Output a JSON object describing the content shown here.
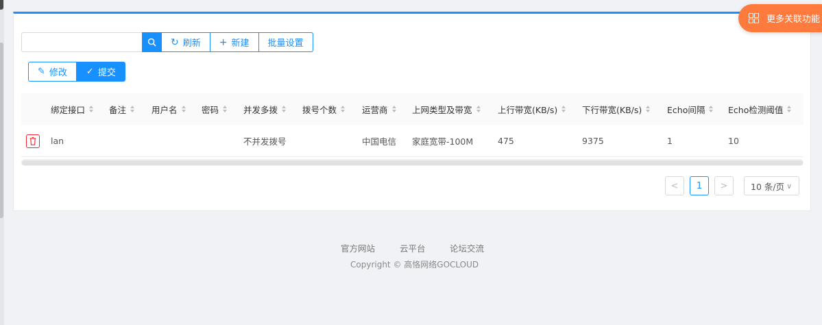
{
  "floating_button": {
    "label": "更多关联功能",
    "icon": "grid-icon",
    "color": "#ff7a3d"
  },
  "toolbar": {
    "search_placeholder": "",
    "search_icon": "search-icon",
    "refresh_label": "刷新",
    "new_label": "新建",
    "batch_label": "批量设置"
  },
  "actions": {
    "edit_label": "修改",
    "submit_label": "提交"
  },
  "table": {
    "columns": [
      "绑定接口",
      "备注",
      "用户名",
      "密码",
      "并发多拨",
      "拨号个数",
      "运营商",
      "上网类型及带宽",
      "上行带宽(KB/s)",
      "下行带宽(KB/s)",
      "Echo间隔",
      "Echo检测阈值"
    ],
    "rows": [
      {
        "interface": "lan",
        "remark": "",
        "username": "",
        "password": "",
        "concurrent": "不并发拨号",
        "dial_count": "",
        "isp": "中国电信",
        "net_type": "家庭宽带-100M",
        "up_bw": "475",
        "down_bw": "9375",
        "echo_interval": "1",
        "echo_threshold": "10"
      }
    ]
  },
  "pagination": {
    "prev": "<",
    "current_page": "1",
    "next": ">",
    "page_size": "10 条/页"
  },
  "footer": {
    "links": [
      "官方网站",
      "云平台",
      "论坛交流"
    ],
    "copyright": "Copyright © 高恪网络GOCLOUD"
  },
  "colors": {
    "primary": "#1890ff",
    "danger": "#f5222d",
    "accent": "#ff7a3d"
  }
}
